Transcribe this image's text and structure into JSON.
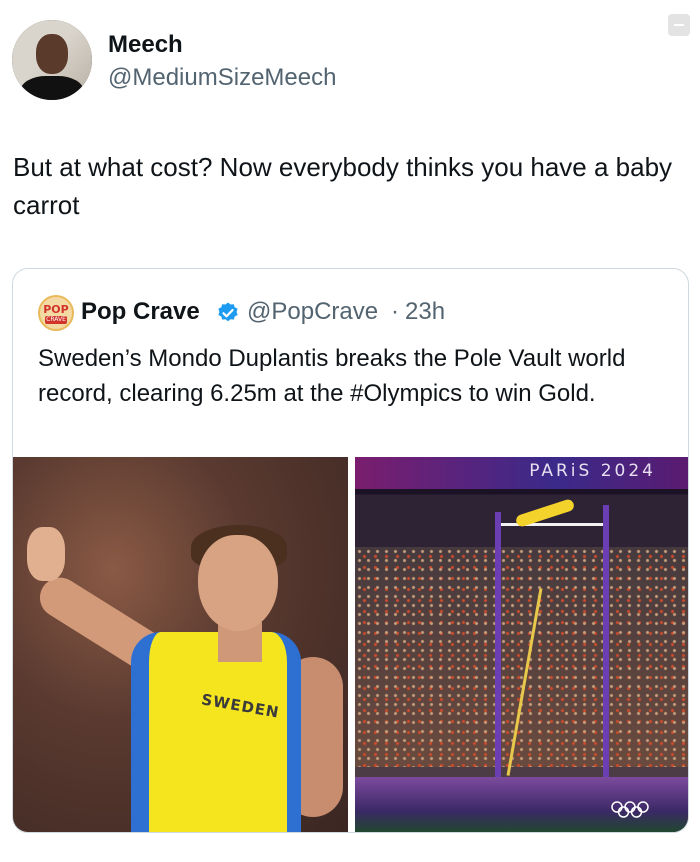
{
  "tweet": {
    "author_name": "Meech",
    "author_handle": "@MediumSizeMeech",
    "text": "But at what cost? Now everybody thinks you have a baby carrot"
  },
  "quoted_tweet": {
    "author_name": "Pop Crave",
    "author_handle": "@PopCrave",
    "separator": "·",
    "time": "23h",
    "logo_text_top": "POP",
    "logo_text_bottom": "CRAVE",
    "text": "Sweden’s Mondo Duplantis breaks the Pole Vault world record, clearing 6.25m at the #Olympics to win Gold.",
    "media": {
      "left_jersey_text": "SWEDEN",
      "right_banner_text": "PARiS 2024"
    }
  },
  "icons": {
    "verified": "verified-badge-icon",
    "more": "more-icon",
    "olympic_rings": "olympic-rings-icon"
  },
  "colors": {
    "verified": "#1d9bf0",
    "secondary_text": "#536471"
  }
}
